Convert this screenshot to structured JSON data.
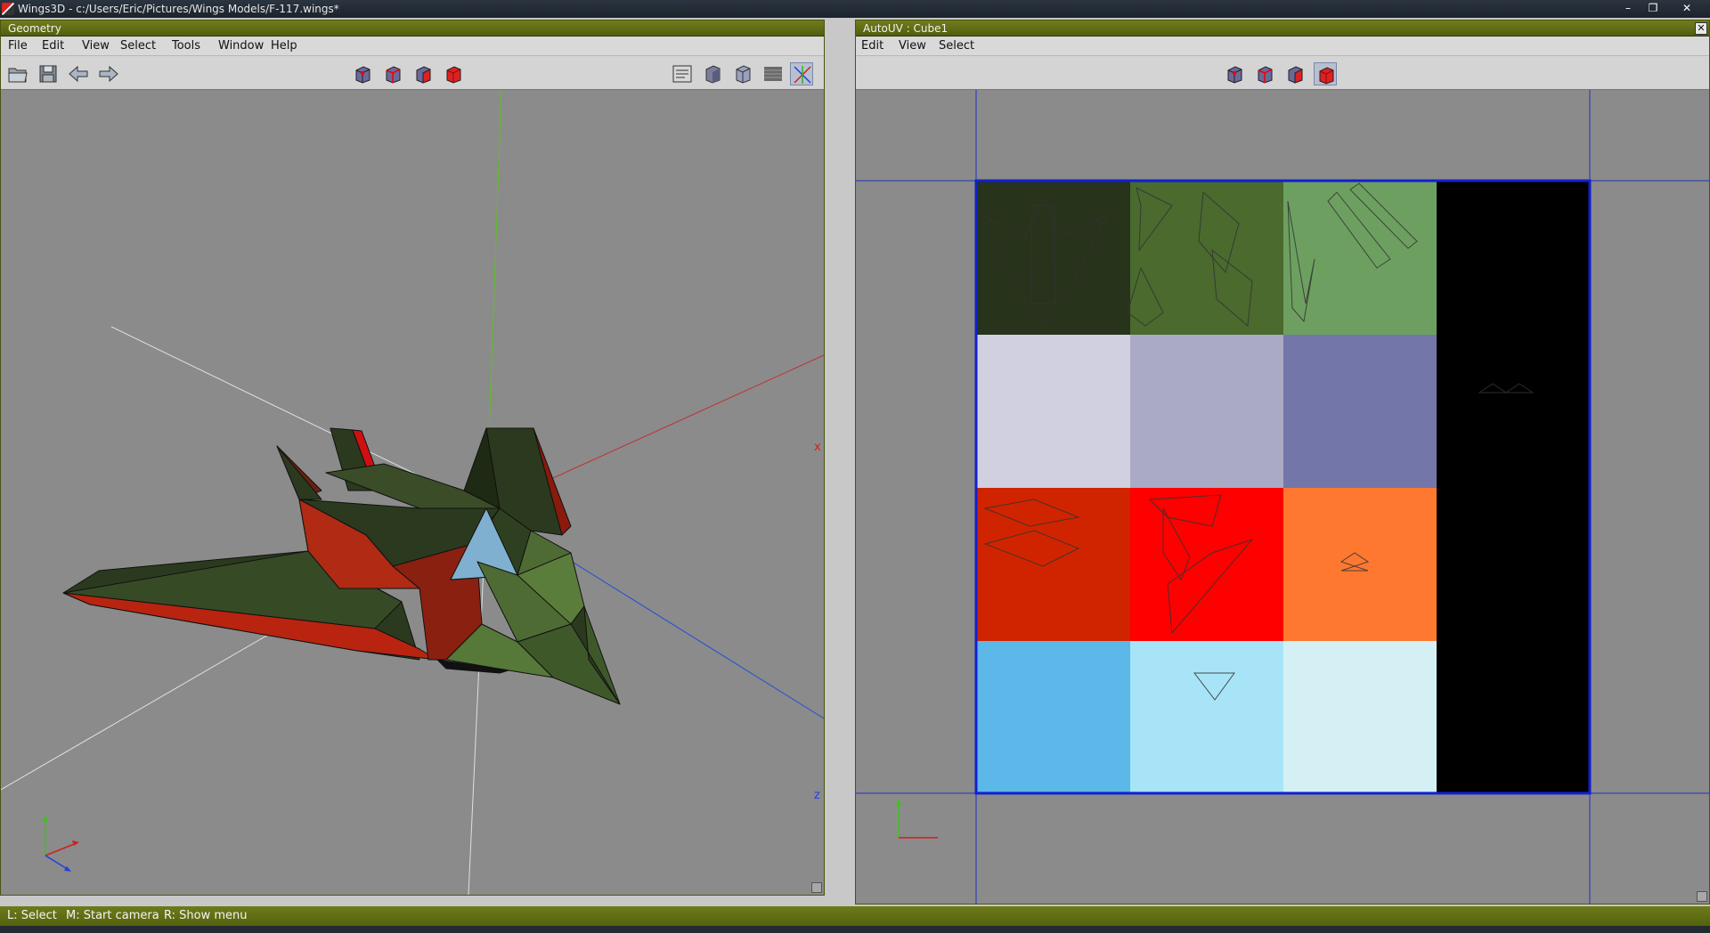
{
  "window": {
    "title": "Wings3D - c:/Users/Eric/Pictures/Wings Models/F-117.wings*",
    "controls": {
      "minimize": "–",
      "maximize": "❐",
      "close": "✕"
    }
  },
  "geometry_panel": {
    "title": "Geometry",
    "menu": [
      "File",
      "Edit",
      "View",
      "Select",
      "Tools",
      "Window",
      "Help"
    ],
    "toolbar_left": [
      "open-icon",
      "save-icon",
      "undo-arrow-icon",
      "redo-arrow-icon"
    ],
    "selection_modes": [
      "vertex-mode-icon",
      "edge-mode-icon",
      "face-mode-icon",
      "body-mode-icon"
    ],
    "view_modes": [
      "groundplane-icon",
      "smooth-shade-icon",
      "wireframe-cube-icon",
      "grid-icon",
      "axes-icon"
    ],
    "axis_labels": {
      "x": "x",
      "z": "z"
    }
  },
  "autouv_panel": {
    "title": "AutoUV : Cube1",
    "close_glyph": "✕",
    "menu": [
      "Edit",
      "View",
      "Select"
    ],
    "selection_modes": [
      "vertex-mode-icon",
      "edge-mode-icon",
      "face-mode-icon",
      "body-mode-icon"
    ],
    "texture_cells": [
      [
        "#27331b",
        "#4a6a2e",
        "#6da060",
        "#000000"
      ],
      [
        "#d0d0e0",
        "#aaaac4",
        "#7376a8",
        "#000000"
      ],
      [
        "#d02400",
        "#ff0000",
        "#ff7830",
        "#000000"
      ],
      [
        "#5cb8e8",
        "#a8e4f8",
        "#d4f0f4",
        "#000000"
      ]
    ]
  },
  "status": {
    "left": "L: Select",
    "middle": "M: Start camera",
    "right": "R: Show menu"
  },
  "colors": {
    "title_green": "#5f6c16",
    "viewport_gray": "#8b8b8b",
    "uv_border_blue": "#1020d0",
    "x_axis": "#d02020",
    "y_axis": "#40c020",
    "z_axis": "#2040e0"
  }
}
